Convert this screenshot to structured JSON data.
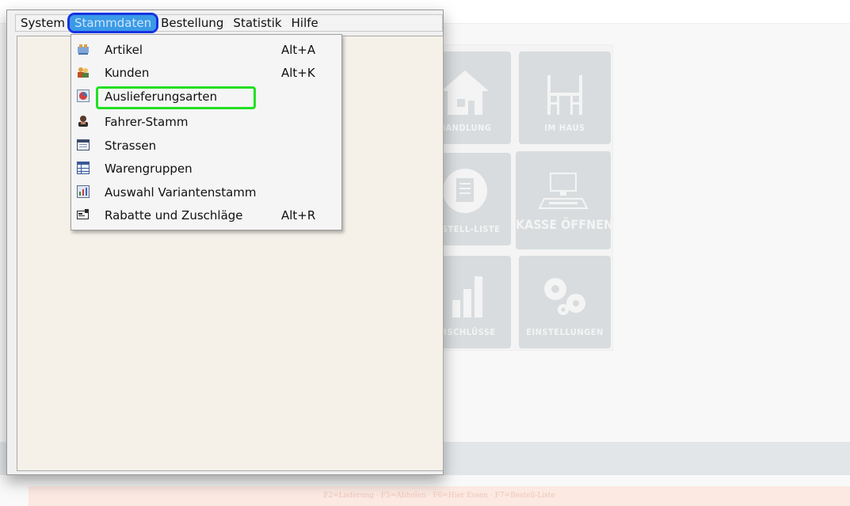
{
  "background_app": {
    "tiles": [
      {
        "label": "HANDLUNG",
        "icon": "house-icon"
      },
      {
        "label": "IM HAUS",
        "icon": "table-chairs-icon"
      },
      {
        "label": "BESTELL-LISTE",
        "icon": "document-icon"
      },
      {
        "label": "KASSE ÖFFNEN",
        "icon": "cash-register-icon"
      },
      {
        "label": "ABSCHLÜSSE",
        "icon": "bar-chart-icon"
      },
      {
        "label": "EINSTELLUNGEN",
        "icon": "gears-icon"
      }
    ],
    "status_text": "F2=Lieferung · F5=Abholen · F6=Hier Essen · F7=Bestell-Liste"
  },
  "menubar": {
    "items": [
      "System",
      "Stammdaten",
      "Bestellung",
      "Statistik",
      "Hilfe"
    ],
    "active": "Stammdaten"
  },
  "dropdown": {
    "items": [
      {
        "label": "Artikel",
        "shortcut": "Alt+A",
        "icon": "articles-icon"
      },
      {
        "label": "Kunden",
        "shortcut": "Alt+K",
        "icon": "customers-icon"
      },
      {
        "label": "Auslieferungsarten",
        "shortcut": "",
        "icon": "delivery-types-icon"
      },
      {
        "label": "Fahrer-Stamm",
        "shortcut": "",
        "icon": "driver-icon"
      },
      {
        "label": "Strassen",
        "shortcut": "",
        "icon": "streets-icon"
      },
      {
        "label": "Warengruppen",
        "shortcut": "",
        "icon": "product-groups-icon"
      },
      {
        "label": "Auswahl Variantenstamm",
        "shortcut": "",
        "icon": "variants-icon"
      },
      {
        "label": "Rabatte und Zuschläge",
        "shortcut": "Alt+R",
        "icon": "discounts-icon"
      }
    ],
    "highlighted": "Auslieferungsarten"
  },
  "colors": {
    "menu_active_bg": "#3a9ae8",
    "menu_active_outline": "#1733e0",
    "highlight_box": "#22e022",
    "tile_bg": "#d8dcde"
  }
}
